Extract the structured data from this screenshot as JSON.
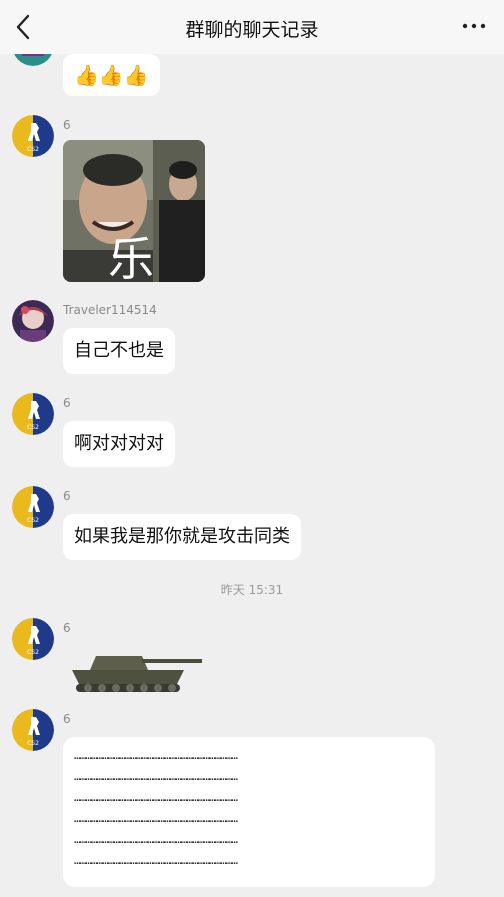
{
  "header": {
    "title": "群聊的聊天记录"
  },
  "messages": {
    "m0": {
      "text": "👍👍👍"
    },
    "m1": {
      "sender": "6"
    },
    "m1_sticker_text": "乐",
    "m2": {
      "sender": "Traveler114514",
      "text": "自己不也是"
    },
    "m3": {
      "sender": "6",
      "text": "啊对对对对"
    },
    "m4": {
      "sender": "6",
      "text": "如果我是那你就是攻击同类"
    },
    "timestamp": "昨天 15:31",
    "m5": {
      "sender": "6"
    },
    "m6": {
      "sender": "6",
      "lines": [
        "……………………………………………………………………………",
        "……………………………………………………………………………",
        "……………………………………………………………………………",
        "……………………………………………………………………………",
        "……………………………………………………………………………",
        "……………………………………………………………………………"
      ]
    }
  },
  "colors": {
    "background": "#efefef",
    "bubble": "#ffffff",
    "avatar_bg": "#1f3a8a",
    "avatar_gold": "#e9b91d"
  },
  "icons": {
    "back": "chevron-left-icon",
    "more": "more-icon"
  }
}
